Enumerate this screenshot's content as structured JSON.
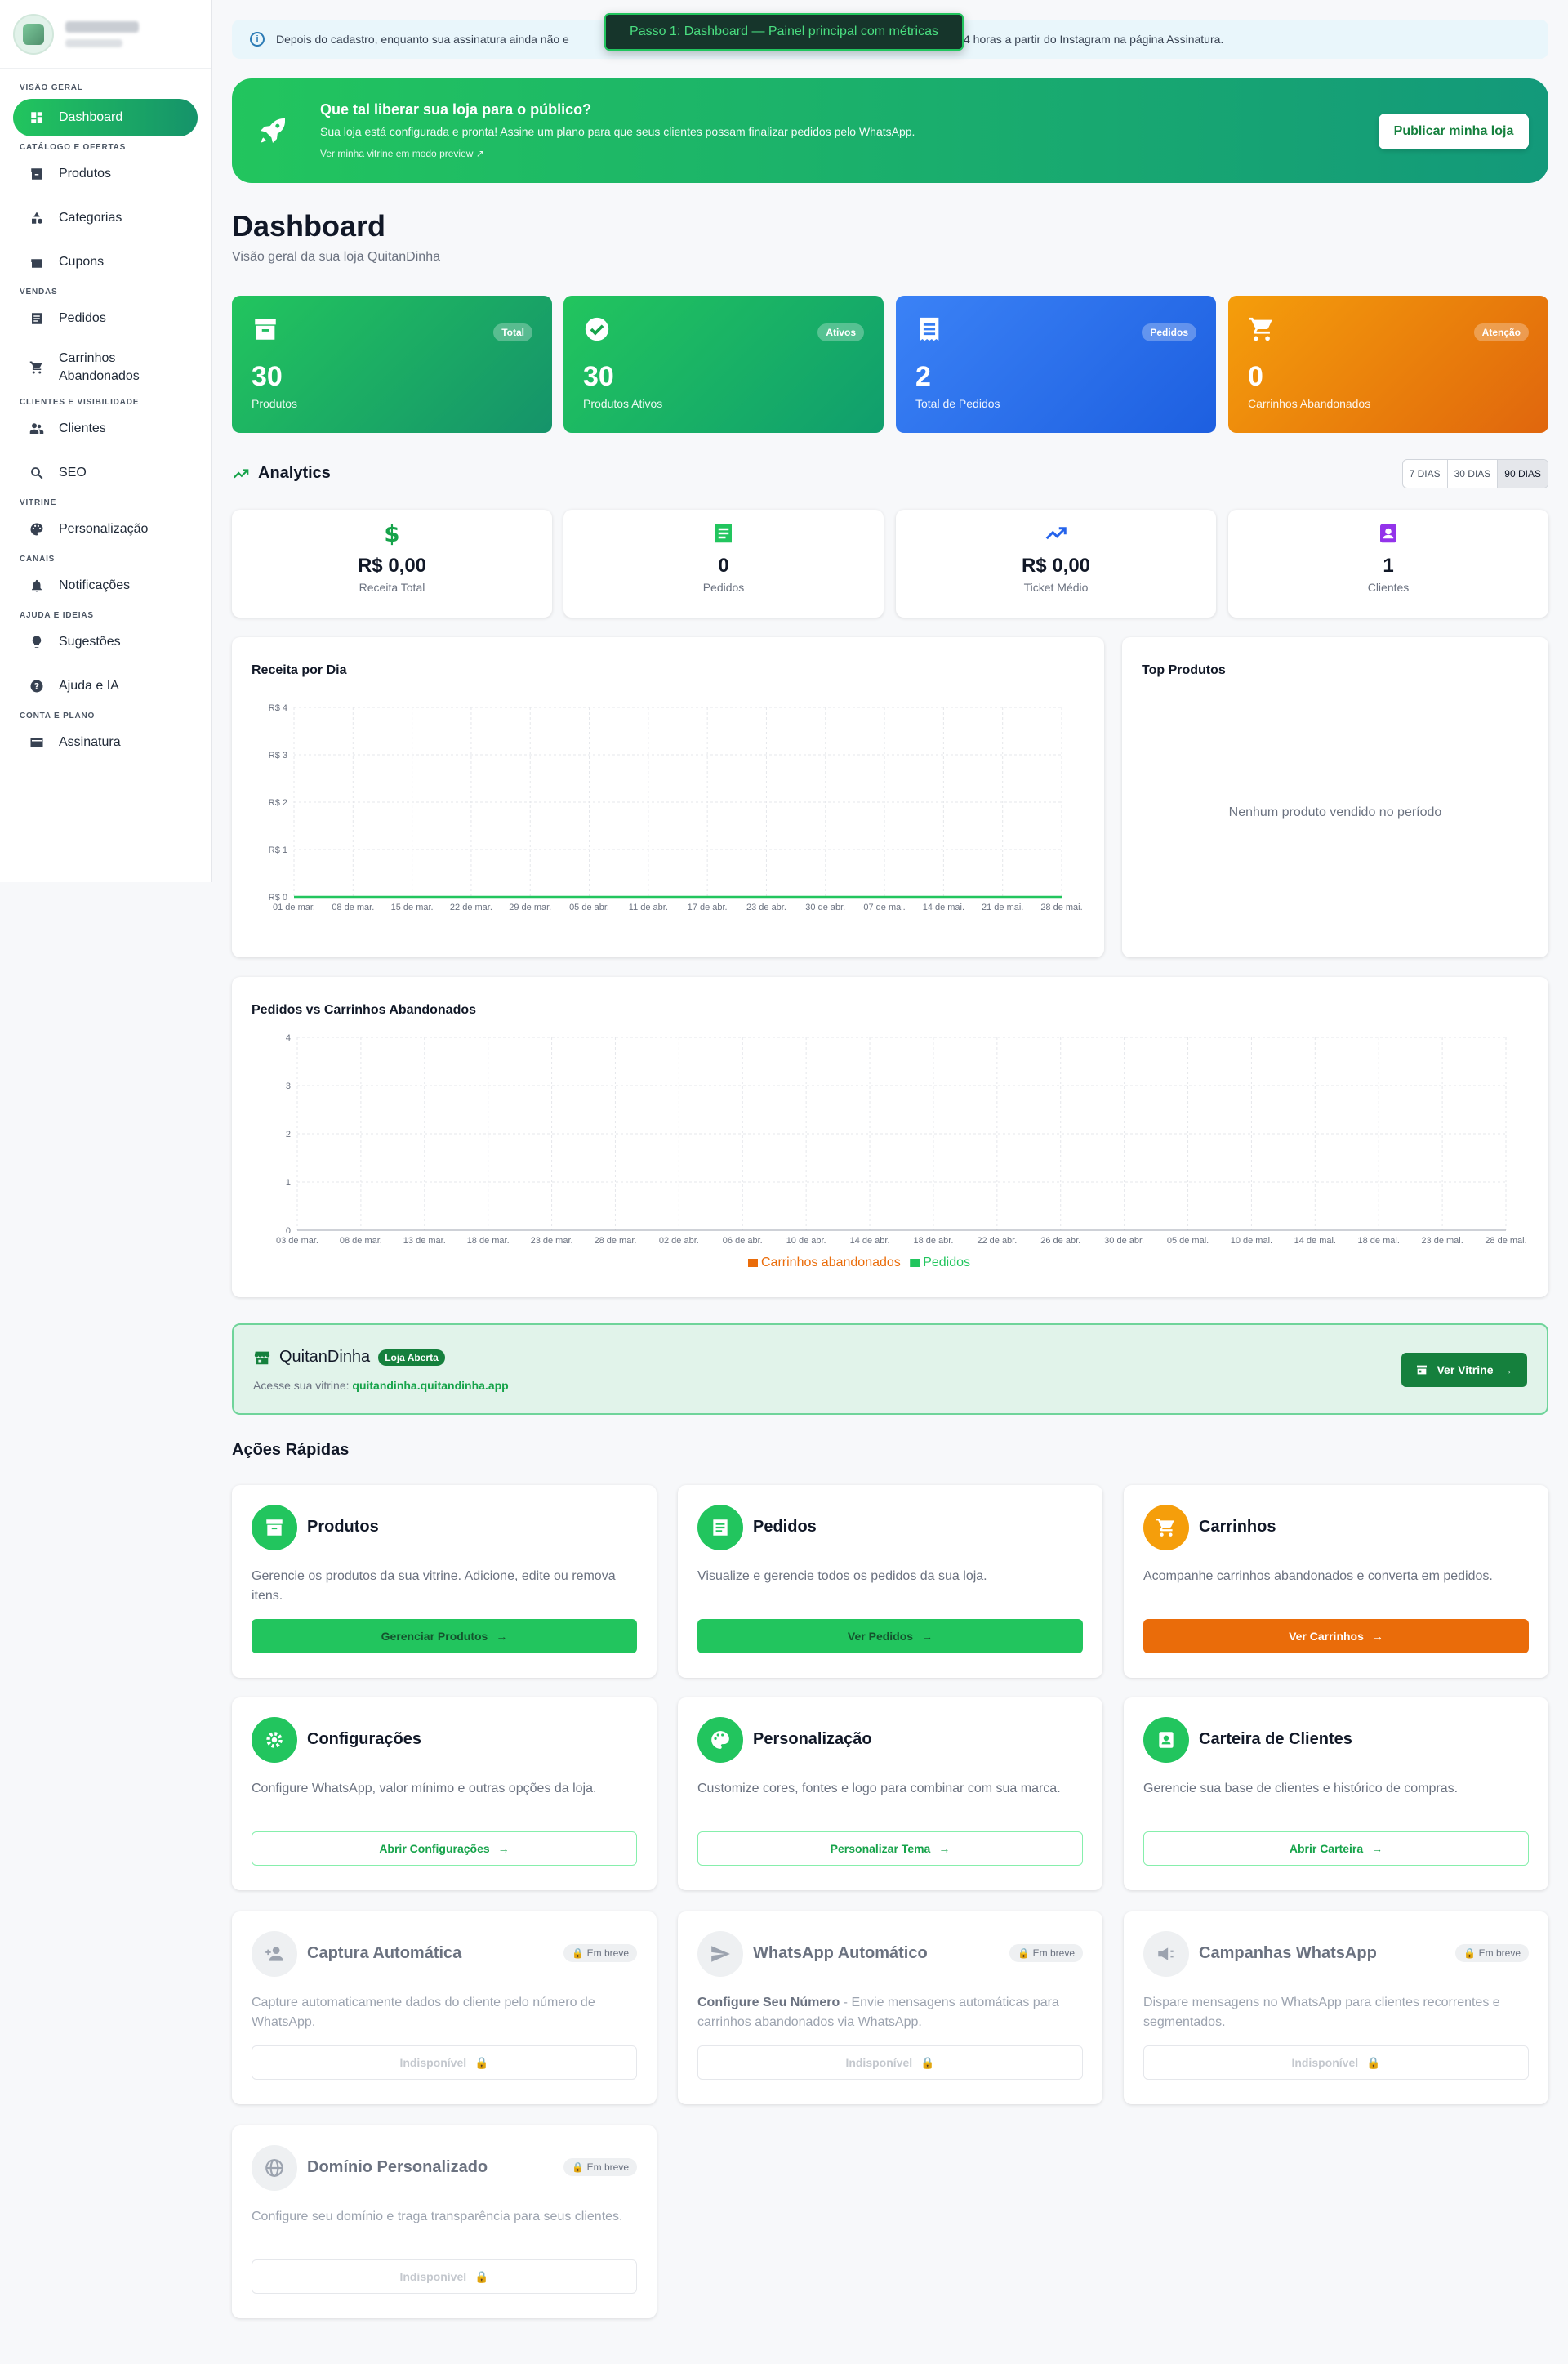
{
  "sidebar": {
    "sections": [
      "Visão geral",
      "Catálogo e ofertas",
      "Vendas",
      "Clientes e visibilidade",
      "Vitrine",
      "Canais",
      "Ajuda e ideias",
      "Conta e plano"
    ],
    "items": [
      "Dashboard",
      "Produtos",
      "Categorias",
      "Cupons",
      "Pedidos",
      "Carrinhos",
      "Abandonados",
      "Clientes",
      "SEO",
      "Personalização",
      "Notificações",
      "Sugestões",
      "Ajuda e IA",
      "Assinatura"
    ]
  },
  "info_bar": {
    "text_left": "Depois do cadastro, enquanto sua assinatura ainda não e",
    "text_right": "4 horas a partir do Instagram na página Assinatura."
  },
  "tooltip": "Passo 1: Dashboard — Painel principal com métricas",
  "banner": {
    "title": "Que tal liberar sua loja para o público?",
    "text": "Sua loja está configurada e pronta! Assine um plano para que seus clientes possam finalizar pedidos pelo WhatsApp.",
    "link": "Ver minha vitrine em modo preview ↗",
    "button": "Publicar minha loja"
  },
  "page": {
    "title": "Dashboard",
    "subtitle": "Visão geral da sua loja QuitanDinha"
  },
  "stats": [
    {
      "badge": "Total",
      "value": "30",
      "label": "Produtos"
    },
    {
      "badge": "Ativos",
      "value": "30",
      "label": "Produtos Ativos"
    },
    {
      "badge": "Pedidos",
      "value": "2",
      "label": "Total de Pedidos"
    },
    {
      "badge": "Atenção",
      "value": "0",
      "label": "Carrinhos Abandonados"
    }
  ],
  "analytics": {
    "title": "Analytics",
    "ranges": [
      "7 DIAS",
      "30 DIAS",
      "90 DIAS"
    ],
    "selected": "90 DIAS"
  },
  "kpis": [
    {
      "value": "R$ 0,00",
      "label": "Receita Total"
    },
    {
      "value": "0",
      "label": "Pedidos"
    },
    {
      "value": "R$ 0,00",
      "label": "Ticket Médio"
    },
    {
      "value": "1",
      "label": "Clientes"
    }
  ],
  "chart_data": [
    {
      "type": "line",
      "title": "Receita por Dia",
      "y_ticks": [
        "R$ 4",
        "R$ 3",
        "R$ 2",
        "R$ 1",
        "R$ 0"
      ],
      "ylim": [
        0,
        4
      ],
      "x_ticks": [
        "01 de mar.",
        "08 de mar.",
        "15 de mar.",
        "22 de mar.",
        "29 de mar.",
        "05 de abr.",
        "11 de abr.",
        "17 de abr.",
        "23 de abr.",
        "30 de abr.",
        "07 de mai.",
        "14 de mai.",
        "21 de mai.",
        "28 de mai."
      ],
      "series": [
        {
          "values": [
            0,
            0,
            0,
            0,
            0,
            0,
            0,
            0,
            0,
            0,
            0,
            0,
            0,
            0
          ],
          "color": "#22c55e"
        }
      ]
    },
    {
      "type": "bar",
      "title": "Pedidos vs Carrinhos Abandonados",
      "y_ticks": [
        "4",
        "3",
        "2",
        "1",
        "0"
      ],
      "ylim": [
        0,
        4
      ],
      "x_ticks": [
        "03 de mar.",
        "08 de mar.",
        "13 de mar.",
        "18 de mar.",
        "23 de mar.",
        "28 de mar.",
        "02 de abr.",
        "06 de abr.",
        "10 de abr.",
        "14 de abr.",
        "18 de abr.",
        "22 de abr.",
        "26 de abr.",
        "30 de abr.",
        "05 de mai.",
        "10 de mai.",
        "14 de mai.",
        "18 de mai.",
        "23 de mai.",
        "28 de mai."
      ],
      "series": [
        {
          "name": "Carrinhos abandonados",
          "color": "#ea6c0a",
          "values": []
        },
        {
          "name": "Pedidos",
          "color": "#22c55e",
          "values": []
        }
      ]
    }
  ],
  "top_products": {
    "title": "Top Produtos",
    "empty": "Nenhum produto vendido no período"
  },
  "store": {
    "name": "QuitanDinha",
    "status": "Loja Aberta",
    "url_label": "Acesse sua vitrine:",
    "url": "quitandinha.quitandinha.app",
    "button": "Ver Vitrine"
  },
  "quick_actions": {
    "title": "Ações Rápidas",
    "cards": [
      {
        "title": "Produtos",
        "desc": "Gerencie os produtos da sua vitrine. Adicione, edite ou remova itens.",
        "button": "Gerenciar Produtos"
      },
      {
        "title": "Pedidos",
        "desc": "Visualize e gerencie todos os pedidos da sua loja.",
        "button": "Ver Pedidos"
      },
      {
        "title": "Carrinhos",
        "desc": "Acompanhe carrinhos abandonados e converta em pedidos.",
        "button": "Ver Carrinhos"
      },
      {
        "title": "Configurações",
        "desc": "Configure WhatsApp, valor mínimo e outras opções da loja.",
        "button": "Abrir Configurações"
      },
      {
        "title": "Personalização",
        "desc": "Customize cores, fontes e logo para combinar com sua marca.",
        "button": "Personalizar Tema"
      },
      {
        "title": "Carteira de Clientes",
        "desc": "Gerencie sua base de clientes e histórico de compras.",
        "button": "Abrir Carteira"
      },
      {
        "title": "Captura Automática",
        "desc": "Capture automaticamente dados do cliente pelo número de WhatsApp.",
        "button": "Indisponível",
        "badge": "Em breve"
      },
      {
        "title": "WhatsApp Automático",
        "desc_bold": "Configure Seu Número",
        "desc": " - Envie mensagens automáticas para carrinhos abandonados via WhatsApp.",
        "button": "Indisponível",
        "badge": "Em breve"
      },
      {
        "title": "Campanhas WhatsApp",
        "desc": "Dispare mensagens no WhatsApp para clientes recorrentes e segmentados.",
        "button": "Indisponível",
        "badge": "Em breve"
      },
      {
        "title": "Domínio Personalizado",
        "desc": "Configure seu domínio e traga transparência para seus clientes.",
        "button": "Indisponível",
        "badge": "Em breve"
      }
    ]
  },
  "colors": {
    "primary": "#22c55e",
    "primary_dark": "#15803d",
    "orange": "#ea6c0a",
    "blue": "#2563eb",
    "teal": "#13997a"
  }
}
